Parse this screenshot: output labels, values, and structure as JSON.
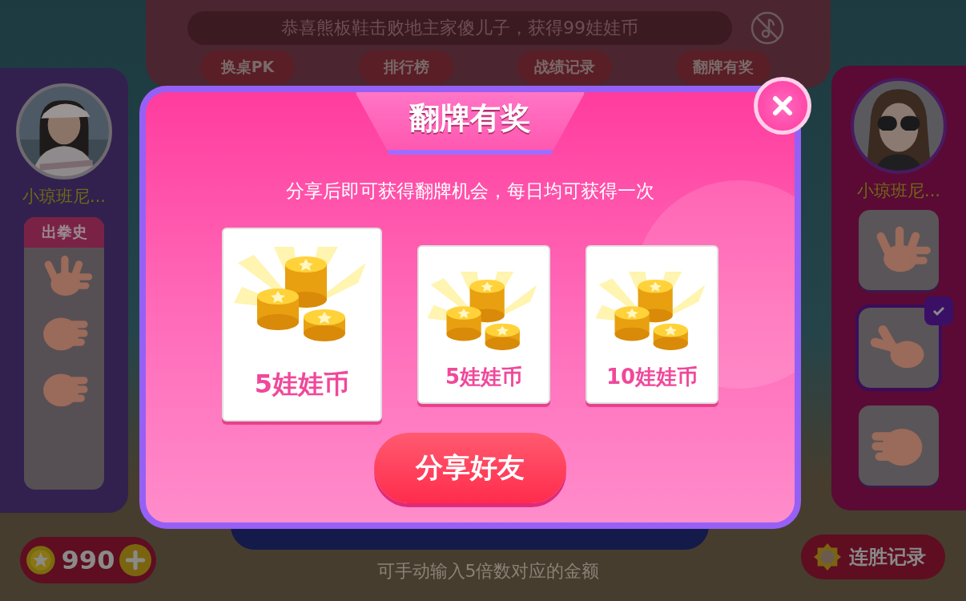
{
  "notice": {
    "text": "恭喜熊板鞋击败地主家傻儿子，获得99娃娃币"
  },
  "nav_buttons": [
    "换桌PK",
    "排行榜",
    "战绩记录",
    "翻牌有奖"
  ],
  "left_player": {
    "name": "小琼班尼...",
    "history_title": "出拳史",
    "history": [
      {
        "kind": "paper"
      },
      {
        "kind": "rock"
      },
      {
        "kind": "rock"
      }
    ]
  },
  "right_player": {
    "name": "小琼班尼...",
    "choices": [
      {
        "kind": "paper",
        "selected": false
      },
      {
        "kind": "scissors",
        "selected": true
      },
      {
        "kind": "rock",
        "selected": false
      }
    ]
  },
  "coins": {
    "amount": "990"
  },
  "hint": "可手动输入5倍数对应的金额",
  "streak_button": "连胜记录",
  "dialog": {
    "title": "翻牌有奖",
    "subtitle": "分享后即可获得翻牌机会，每日均可获得一次",
    "cards": [
      {
        "label": "5娃娃币",
        "selected": true
      },
      {
        "label": "5娃娃币",
        "selected": false
      },
      {
        "label": "10娃娃币",
        "selected": false
      }
    ],
    "share_button": "分享好友"
  }
}
